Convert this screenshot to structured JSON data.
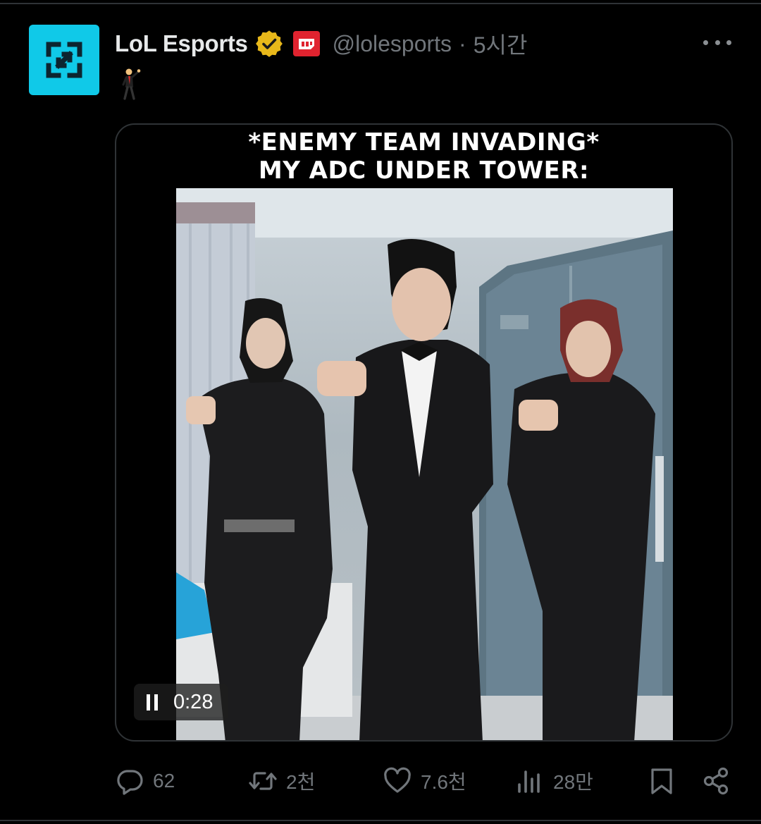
{
  "tweet": {
    "author_name": "LoL Esports",
    "handle": "@lolesports",
    "separator": "·",
    "time": "5시간",
    "body_emoji": "🕺",
    "verified_color": "#e8b81a",
    "avatar_color": "#10c9e8",
    "affiliate_badge_color": "#e0232f"
  },
  "media": {
    "caption_line1": "*ENEMY TEAM INVADING*",
    "caption_line2": "MY ADC UNDER TOWER:",
    "timestamp": "0:28",
    "playback_state": "playing"
  },
  "actions": {
    "replies": "62",
    "retweets": "2천",
    "likes": "7.6천",
    "views": "28만"
  },
  "icons": [
    "lol-esports-logo-icon",
    "verified-badge-icon",
    "affiliate-badge-icon",
    "more-icon",
    "pause-icon",
    "reply-icon",
    "retweet-icon",
    "like-icon",
    "views-icon",
    "bookmark-icon",
    "share-icon"
  ]
}
